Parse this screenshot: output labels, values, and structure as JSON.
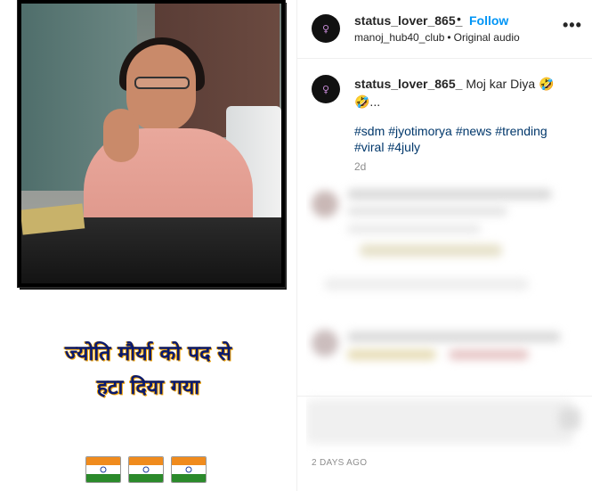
{
  "media": {
    "caption_line1": "ज्योति मौर्या को पद से",
    "caption_line2": "हटा दिया गया",
    "flags_count": 3
  },
  "header": {
    "username": "status_lover_865_",
    "separator": "•",
    "follow_label": "Follow",
    "collab_user": "manoj_hub40_club",
    "audio_label": "Original audio",
    "more_icon": "more-horizontal-icon",
    "more_glyph": "•••"
  },
  "post": {
    "username": "status_lover_865_",
    "text": "Moj kar Diya 🤣",
    "text_more": "🤣...",
    "hashtags": [
      "#sdm",
      "#jyotimorya",
      "#news",
      "#trending",
      "#viral",
      "#4july"
    ],
    "time_short": "2d"
  },
  "footer": {
    "time_label": "2 DAYS AGO"
  },
  "colors": {
    "follow": "#0095f6",
    "hashtag": "#00376b",
    "muted": "#8e8e8e",
    "caption_text": "#0a1a6e",
    "caption_outline": "#f4a300"
  }
}
